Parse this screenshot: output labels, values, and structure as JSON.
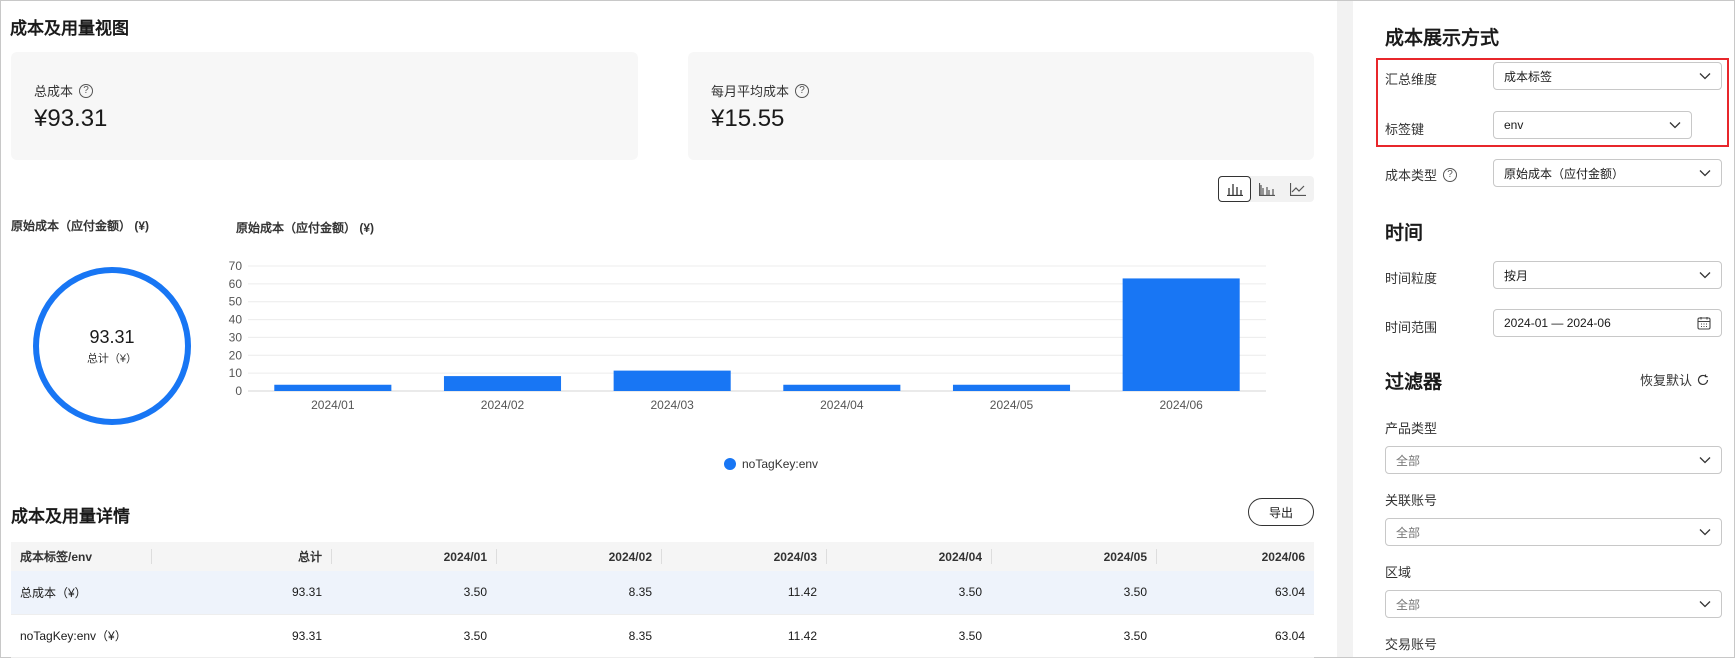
{
  "main": {
    "title": "成本及用量视图",
    "cards": [
      {
        "label": "总成本",
        "value": "¥93.31"
      },
      {
        "label": "每月平均成本",
        "value": "¥15.55"
      }
    ],
    "donut_caption": "原始成本（应付金额） (¥)",
    "bar_caption": "原始成本（应付金额） (¥)",
    "donut": {
      "value": "93.31",
      "sub": "总计（¥）"
    },
    "legend": "noTagKey:env",
    "details_title": "成本及用量详情",
    "export_label": "导出"
  },
  "chart_data": [
    {
      "type": "pie",
      "categories": [
        "noTagKey:env"
      ],
      "values": [
        93.31
      ],
      "title": "原始成本（应付金额） (¥)"
    },
    {
      "type": "bar",
      "title": "原始成本（应付金额） (¥)",
      "categories": [
        "2024/01",
        "2024/02",
        "2024/03",
        "2024/04",
        "2024/05",
        "2024/06"
      ],
      "series": [
        {
          "name": "noTagKey:env",
          "values": [
            3.5,
            8.35,
            11.42,
            3.5,
            3.5,
            63.04
          ],
          "color": "#1876f4"
        }
      ],
      "ylim": [
        0,
        70
      ],
      "yticks": [
        0,
        10,
        20,
        30,
        40,
        50,
        60,
        70
      ],
      "grid": true,
      "legend": "bottom-center"
    }
  ],
  "table": {
    "headers": [
      "成本标签/env",
      "总计",
      "2024/01",
      "2024/02",
      "2024/03",
      "2024/04",
      "2024/05",
      "2024/06"
    ],
    "rows": [
      [
        "总成本（¥）",
        "93.31",
        "3.50",
        "8.35",
        "11.42",
        "3.50",
        "3.50",
        "63.04"
      ],
      [
        "noTagKey:env（¥）",
        "93.31",
        "3.50",
        "8.35",
        "11.42",
        "3.50",
        "3.50",
        "63.04"
      ]
    ]
  },
  "sidebar": {
    "display_title": "成本展示方式",
    "dimension_label": "汇总维度",
    "dimension_value": "成本标签",
    "tagkey_label": "标签键",
    "tagkey_value": "env",
    "costtype_label": "成本类型",
    "costtype_value": "原始成本（应付金额）",
    "time_title": "时间",
    "granularity_label": "时间粒度",
    "granularity_value": "按月",
    "range_label": "时间范围",
    "range_value": "2024-01 — 2024-06",
    "filter_title": "过滤器",
    "reset_label": "恢复默认",
    "filters": [
      {
        "label": "产品类型",
        "value": "全部"
      },
      {
        "label": "关联账号",
        "value": "全部"
      },
      {
        "label": "区域",
        "value": "全部"
      },
      {
        "label": "交易账号",
        "value": ""
      }
    ]
  },
  "colors": {
    "accent": "#1876f4",
    "highlight": "#e8262b"
  },
  "icons": [
    "help-icon",
    "chevron-down-icon",
    "calendar-icon",
    "refresh-icon",
    "bar-chart-icon",
    "grouped-bar-icon",
    "line-chart-icon"
  ]
}
